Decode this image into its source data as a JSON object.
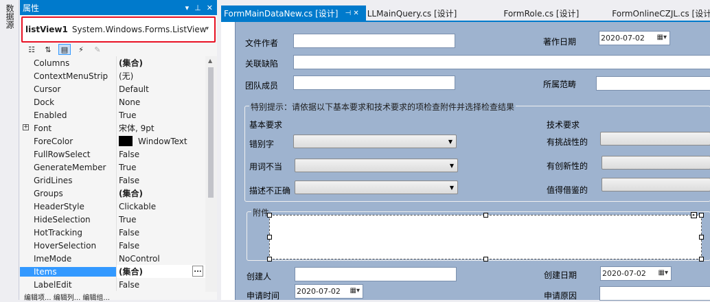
{
  "left_strip": {
    "tab_label": "数据源"
  },
  "properties_panel": {
    "title": "属性",
    "title_buttons": [
      "▾",
      "📌",
      "✕"
    ],
    "object_selector": {
      "name": "listView1",
      "type": "System.Windows.Forms.ListView"
    },
    "rows": [
      {
        "name": "Columns",
        "value": "(集合)",
        "bold": true
      },
      {
        "name": "ContextMenuStrip",
        "value": "(无)"
      },
      {
        "name": "Cursor",
        "value": "Default"
      },
      {
        "name": "Dock",
        "value": "None"
      },
      {
        "name": "Enabled",
        "value": "True"
      },
      {
        "name": "Font",
        "value": "宋体, 9pt",
        "expandable": true
      },
      {
        "name": "ForeColor",
        "value": "WindowText",
        "swatch": "#000000"
      },
      {
        "name": "FullRowSelect",
        "value": "False"
      },
      {
        "name": "GenerateMember",
        "value": "True"
      },
      {
        "name": "GridLines",
        "value": "False"
      },
      {
        "name": "Groups",
        "value": "(集合)",
        "bold": true
      },
      {
        "name": "HeaderStyle",
        "value": "Clickable"
      },
      {
        "name": "HideSelection",
        "value": "True"
      },
      {
        "name": "HotTracking",
        "value": "False"
      },
      {
        "name": "HoverSelection",
        "value": "False"
      },
      {
        "name": "ImeMode",
        "value": "NoControl"
      },
      {
        "name": "Items",
        "value": "(集合)",
        "bold": true,
        "selected": true,
        "ellipsis": "..."
      },
      {
        "name": "LabelEdit",
        "value": "False"
      }
    ],
    "bottom_text": "编辑项... 编辑列... 编辑组..."
  },
  "tabs": [
    {
      "label": "FormMainDataNew.cs [设计]",
      "active": true,
      "pin": "⊣ ✕"
    },
    {
      "label": "LLMainQuery.cs [设计]",
      "active": false
    },
    {
      "label": "FormRole.cs [设计]",
      "active": false
    },
    {
      "label": "FormOnlineCZJL.cs [设计]",
      "active": false
    }
  ],
  "form": {
    "file_author_label": "文件作者",
    "work_date_label": "著作日期",
    "work_date_value": "2020-07-02",
    "related_defect_label": "关联缺陷",
    "team_members_label": "团队成员",
    "scope_label": "所属范畴",
    "notice_group_label": "特别提示：请依据以下基本要求和技术要求的项检查附件并选择检查结果",
    "basic_req_label": "基本要求",
    "tech_req_label": "技术要求",
    "typo_label": "错别字",
    "wording_label": "用词不当",
    "inaccurate_label": "描述不正确",
    "challenging_label": "有挑战性的",
    "innovative_label": "有创新性的",
    "reference_label": "值得借鉴的",
    "attachment_label": "附件",
    "creator_label": "创建人",
    "create_date_label": "创建日期",
    "create_date_value": "2020-07-02",
    "apply_time_label": "申请时间",
    "apply_time_value": "2020-07-02",
    "apply_reason_label": "申请原因"
  }
}
